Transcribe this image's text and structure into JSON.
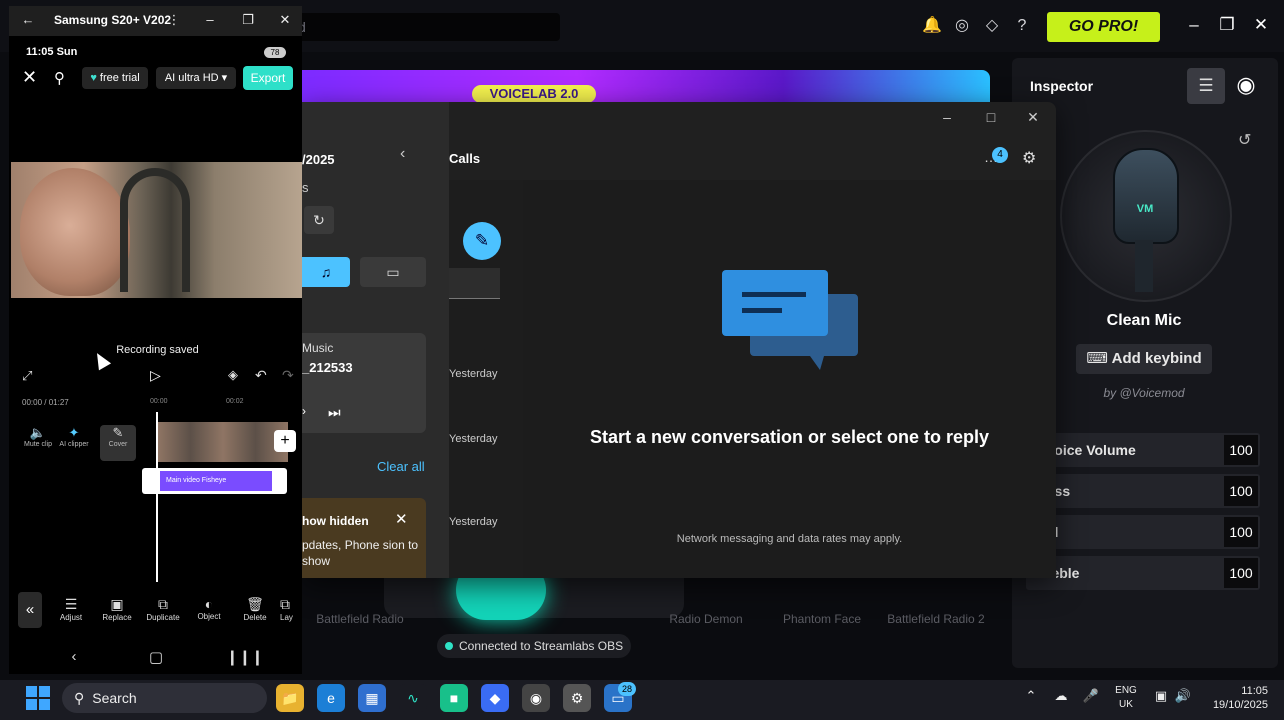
{
  "voicemod": {
    "search_placeholder": "d",
    "go_pro": "GO PRO!",
    "banner": "VOICELAB 2.0",
    "inspector": {
      "title": "Inspector",
      "voice_name": "Clean Mic",
      "keybind_label": "Add keybind",
      "author": "by @Voicemod",
      "mic_logo": "VM",
      "sliders": [
        {
          "label": "Voice Volume",
          "value": "100"
        },
        {
          "label": "uss",
          "value": "100"
        },
        {
          "label": "id",
          "value": "100"
        },
        {
          "label": "reble",
          "value": "100"
        }
      ]
    },
    "voices": [
      "Battlefield Radio",
      "Radio Demon",
      "Phantom Face",
      "Battlefield Radio 2"
    ],
    "obs_status": "Connected to Streamlabs OBS"
  },
  "phone_link": {
    "date_fragment": "/2025",
    "s_fragment": "s",
    "header": "Calls",
    "badge": "4",
    "music_label": "Music",
    "music_track": "_212533",
    "yesterday": [
      "Yesterday",
      "Yesterday",
      "Yesterday"
    ],
    "clear_all": "Clear all",
    "notif_title": "how hidden",
    "notif_body": "pdates, Phone sion to show",
    "empty_title": "Start a new conversation or select one to reply",
    "footer": "Network messaging and data rates may apply."
  },
  "phone": {
    "window_title": "Samsung S20+ V202",
    "status_time": "11:05 Sun",
    "battery": "78",
    "free_trial": "free trial",
    "quality": "AI ultra HD",
    "export": "Export",
    "recording_saved": "Recording saved",
    "time_current": "00:00",
    "time_total": "/ 01:27",
    "ticks": [
      "00:00",
      "00:02"
    ],
    "track_tools": [
      "Mute clip",
      "AI clipper",
      "Cover"
    ],
    "fx_label": "Main video  Fisheye",
    "bottom_tools": [
      "Adjust",
      "Replace",
      "Duplicate",
      "Object",
      "Delete",
      "Lay"
    ]
  },
  "taskbar": {
    "search": "Search",
    "messages_badge": "28",
    "lang_line1": "ENG",
    "lang_line2": "UK",
    "time": "11:05",
    "date": "19/10/2025"
  }
}
